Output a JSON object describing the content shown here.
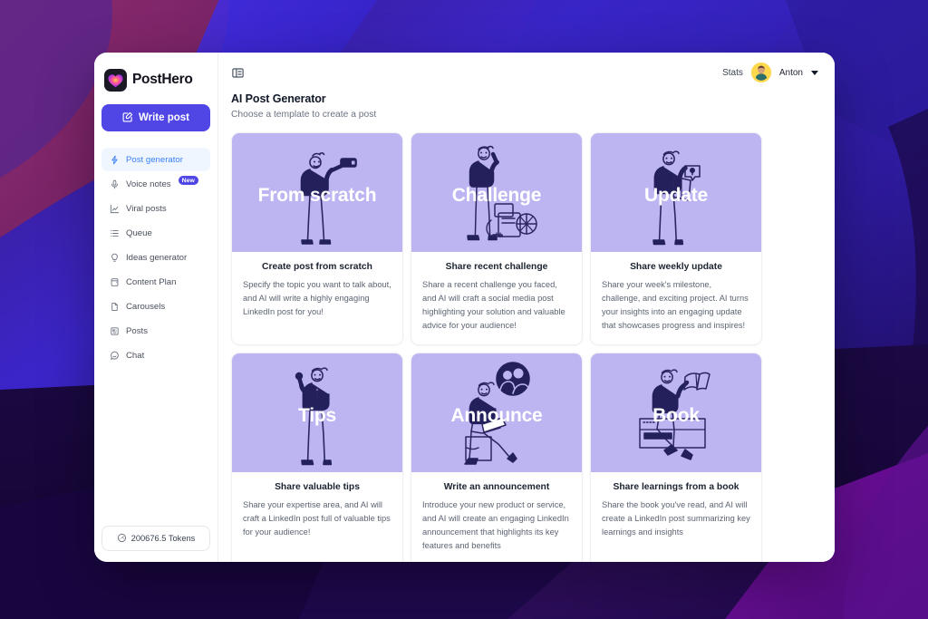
{
  "brand": {
    "name": "PostHero",
    "logo_icon": "heart-gradient-logo"
  },
  "sidebar": {
    "write_post": {
      "label": "Write post",
      "icon": "pencil-square-icon"
    },
    "items": [
      {
        "label": "Post generator",
        "icon": "lightning-icon",
        "active": true
      },
      {
        "label": "Voice notes",
        "icon": "microphone-icon",
        "badge": "New"
      },
      {
        "label": "Viral posts",
        "icon": "chart-icon"
      },
      {
        "label": "Queue",
        "icon": "list-icon"
      },
      {
        "label": "Ideas generator",
        "icon": "lightbulb-icon"
      },
      {
        "label": "Content Plan",
        "icon": "calendar-icon"
      },
      {
        "label": "Carousels",
        "icon": "document-icon"
      },
      {
        "label": "Posts",
        "icon": "posts-icon"
      },
      {
        "label": "Chat",
        "icon": "chat-icon"
      }
    ],
    "tokens": {
      "label": "200676.5 Tokens",
      "icon": "gauge-icon"
    }
  },
  "topbar": {
    "panel_toggle_icon": "panel-collapse-icon",
    "stats_label": "Stats",
    "user_name": "Anton",
    "avatar_icon": "user-avatar",
    "caret_icon": "chevron-down-icon"
  },
  "page": {
    "title": "AI Post Generator",
    "subtitle": "Choose a template to create a post"
  },
  "templates": [
    {
      "art_word": "From scratch",
      "title": "Create post from scratch",
      "description": "Specify the topic you want to talk about, and AI will write a highly engaging LinkedIn post for you!",
      "art_icon": "person-taking-selfie-illustration"
    },
    {
      "art_word": "Challenge",
      "title": "Share recent challenge",
      "description": "Share a recent challenge you faced, and AI will craft a social media post highlighting your solution and valuable advice for your audience!",
      "art_icon": "person-with-obstacles-illustration"
    },
    {
      "art_word": "Update",
      "title": "Share weekly update",
      "description": "Share your week's milestone, challenge, and exciting project. AI turns your insights into an engaging update that showcases progress and inspires!",
      "art_icon": "person-holding-map-illustration"
    },
    {
      "art_word": "Tips",
      "title": "Share valuable tips",
      "description": "Share your expertise area, and AI will craft a LinkedIn post full of valuable tips for your audience!",
      "art_icon": "person-pointing-up-illustration"
    },
    {
      "art_word": "Announce",
      "title": "Write an announcement",
      "description": "Introduce your new product or service, and AI will create an engaging LinkedIn announcement that highlights its key features and benefits",
      "art_icon": "person-with-laptop-illustration"
    },
    {
      "art_word": "Book",
      "title": "Share learnings from a book",
      "description": "Share the book you've read, and AI will create a LinkedIn post summarizing key learnings and insights",
      "art_icon": "person-reading-book-illustration"
    }
  ],
  "colors": {
    "accent": "#4f46e5",
    "active_nav_bg": "#eff6ff",
    "active_nav_text": "#3b82f6",
    "card_art_bg": "#bdb5f2",
    "illustration_ink": "#1e1b4b",
    "badge_bg": "#4f46e5"
  }
}
